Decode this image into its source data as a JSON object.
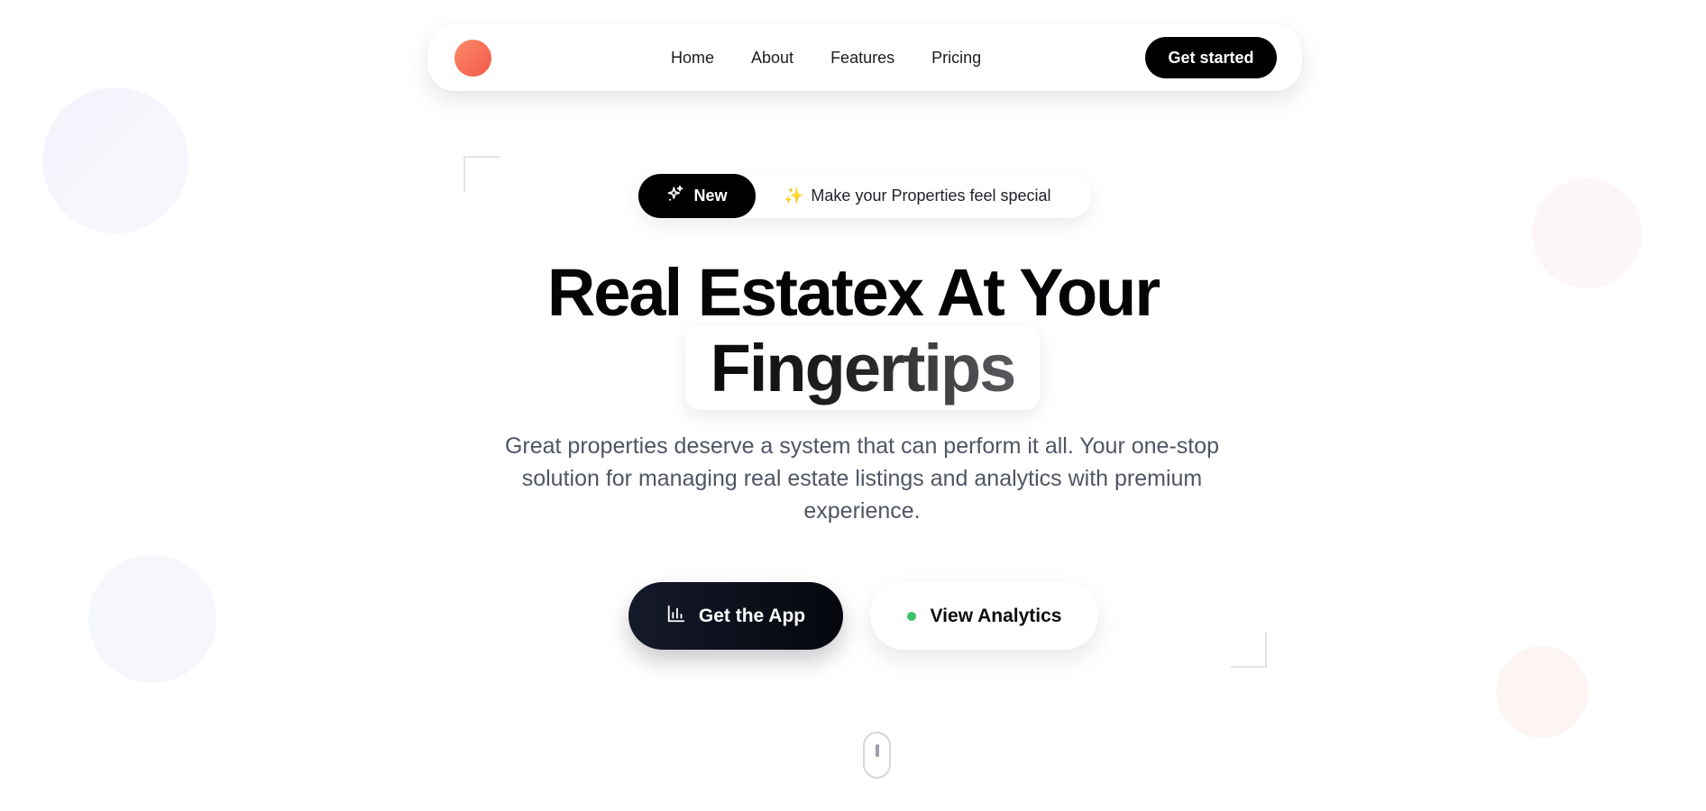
{
  "nav": {
    "links": [
      "Home",
      "About",
      "Features",
      "Pricing"
    ],
    "cta_label": "Get started"
  },
  "announcement": {
    "badge_label": "New",
    "badge_icon": "sparkles-icon",
    "emoji": "✨",
    "text": "Make your Properties feel special"
  },
  "hero": {
    "title_line1": "Real Estatex At Your",
    "title_highlight": "Fingertips",
    "description": "Great properties deserve a system that can perform it all. Your one-stop solution for managing real estate listings and analytics with premium experience."
  },
  "buttons": {
    "primary_label": "Get the App",
    "primary_icon": "bar-chart-icon",
    "secondary_label": "View Analytics",
    "secondary_dot_color": "#3cc26b"
  },
  "colors": {
    "logo_gradient": [
      "#ff8a6a",
      "#f0594a"
    ],
    "primary_dark": "#000000",
    "text_muted": "#4f5563"
  },
  "scroll_indicator": "mouse-icon"
}
